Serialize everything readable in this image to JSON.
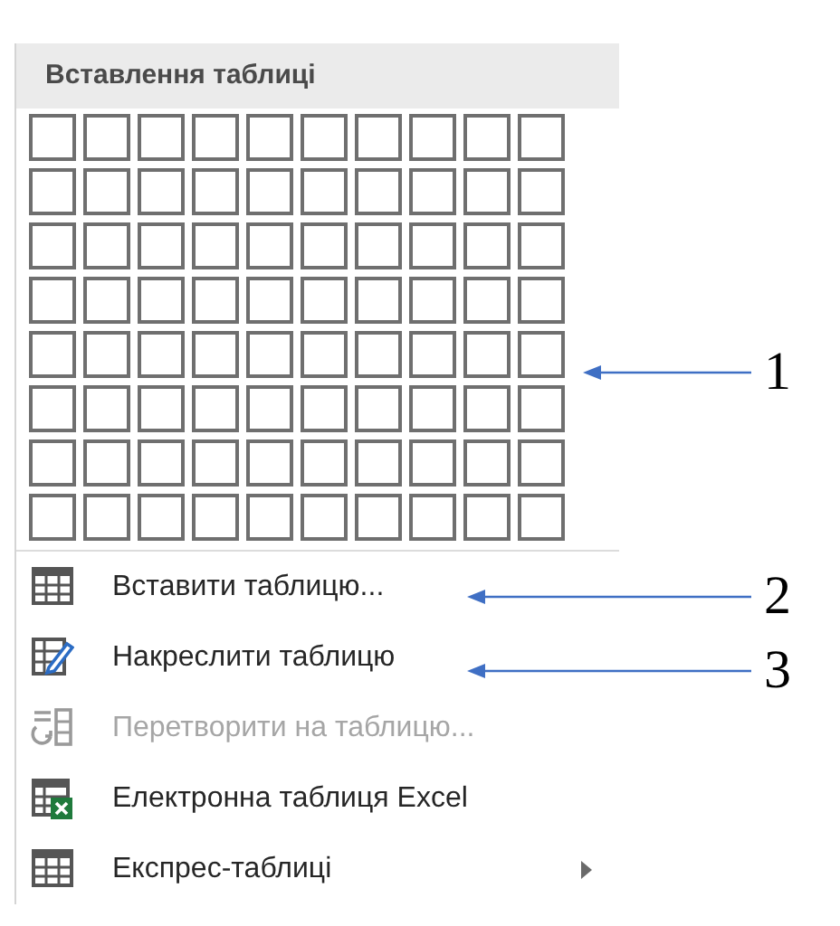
{
  "menu": {
    "title": "Вставлення таблиці",
    "grid": [
      [
        {
          "selected": false
        },
        {
          "selected": false
        },
        {
          "selected": false
        },
        {
          "selected": false
        },
        {
          "selected": false
        },
        {
          "selected": false
        },
        {
          "selected": false
        },
        {
          "selected": false
        },
        {
          "selected": false
        },
        {
          "selected": false
        }
      ],
      [
        {
          "selected": false
        },
        {
          "selected": false
        },
        {
          "selected": false
        },
        {
          "selected": false
        },
        {
          "selected": false
        },
        {
          "selected": false
        },
        {
          "selected": false
        },
        {
          "selected": false
        },
        {
          "selected": false
        },
        {
          "selected": false
        }
      ],
      [
        {
          "selected": false
        },
        {
          "selected": false
        },
        {
          "selected": false
        },
        {
          "selected": false
        },
        {
          "selected": false
        },
        {
          "selected": false
        },
        {
          "selected": false
        },
        {
          "selected": false
        },
        {
          "selected": false
        },
        {
          "selected": false
        }
      ],
      [
        {
          "selected": false
        },
        {
          "selected": false
        },
        {
          "selected": false
        },
        {
          "selected": false
        },
        {
          "selected": false
        },
        {
          "selected": false
        },
        {
          "selected": false
        },
        {
          "selected": false
        },
        {
          "selected": false
        },
        {
          "selected": false
        }
      ],
      [
        {
          "selected": false
        },
        {
          "selected": false
        },
        {
          "selected": false
        },
        {
          "selected": false
        },
        {
          "selected": false
        },
        {
          "selected": false
        },
        {
          "selected": false
        },
        {
          "selected": false
        },
        {
          "selected": false
        },
        {
          "selected": false
        }
      ],
      [
        {
          "selected": false
        },
        {
          "selected": false
        },
        {
          "selected": false
        },
        {
          "selected": false
        },
        {
          "selected": false
        },
        {
          "selected": false
        },
        {
          "selected": false
        },
        {
          "selected": false
        },
        {
          "selected": false
        },
        {
          "selected": false
        }
      ],
      [
        {
          "selected": false
        },
        {
          "selected": false
        },
        {
          "selected": false
        },
        {
          "selected": false
        },
        {
          "selected": false
        },
        {
          "selected": false
        },
        {
          "selected": false
        },
        {
          "selected": false
        },
        {
          "selected": false
        },
        {
          "selected": false
        }
      ],
      [
        {
          "selected": false
        },
        {
          "selected": false
        },
        {
          "selected": false
        },
        {
          "selected": false
        },
        {
          "selected": false
        },
        {
          "selected": false
        },
        {
          "selected": false
        },
        {
          "selected": false
        },
        {
          "selected": false
        },
        {
          "selected": false
        }
      ]
    ],
    "items": [
      {
        "kind": "table",
        "label": "Вставити таблицю...",
        "disabled": false,
        "submenu": false
      },
      {
        "kind": "draw",
        "label": "Накреслити таблицю",
        "disabled": false,
        "submenu": false
      },
      {
        "kind": "convert",
        "label": "Перетворити на таблицю...",
        "disabled": true,
        "submenu": false
      },
      {
        "kind": "excel",
        "label": "Електронна таблиця Excel",
        "disabled": false,
        "submenu": false
      },
      {
        "kind": "table",
        "label": "Експрес-таблиці",
        "disabled": false,
        "submenu": true
      }
    ]
  },
  "callouts": [
    {
      "label": "1"
    },
    {
      "label": "2"
    },
    {
      "label": "3"
    }
  ]
}
